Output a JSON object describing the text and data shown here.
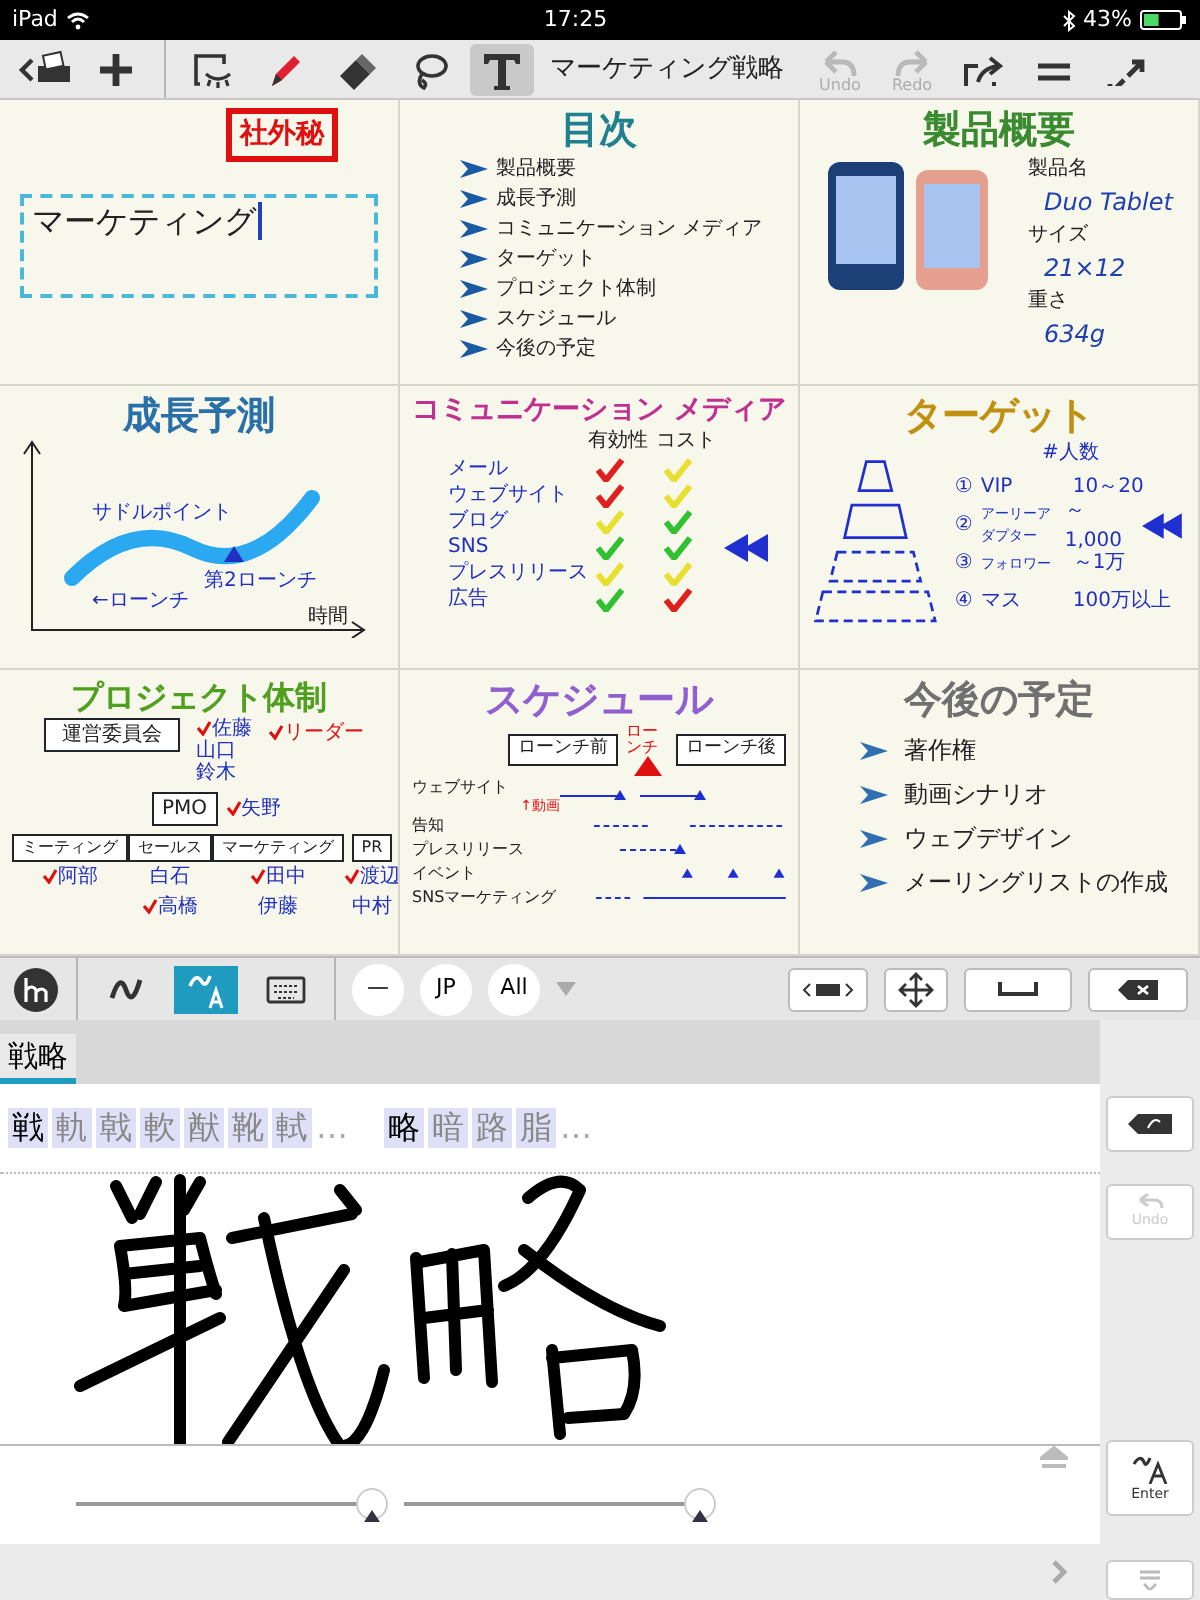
{
  "status_bar": {
    "device": "iPad",
    "time": "17:25",
    "battery": "43%"
  },
  "toolbar": {
    "tools": [
      {
        "kind": "back"
      },
      {
        "kind": "add"
      },
      {
        "kind": "select",
        "selected": false
      },
      {
        "kind": "pen",
        "selected": false
      },
      {
        "kind": "eraser",
        "selected": false
      },
      {
        "kind": "lasso",
        "selected": false
      },
      {
        "kind": "text",
        "selected": true
      }
    ],
    "title": "マーケティング戦略",
    "actions": [
      {
        "kind": "undo",
        "label": "Undo",
        "disabled": true
      },
      {
        "kind": "redo",
        "label": "Redo",
        "disabled": true
      },
      {
        "kind": "share"
      },
      {
        "kind": "menu"
      },
      {
        "kind": "expand"
      }
    ]
  },
  "panels": [
    {
      "kind": "cover",
      "stamp": "社外秘",
      "textbox": "マーケティング"
    },
    {
      "kind": "toc",
      "title": "目次",
      "items": [
        "製品概要",
        "成長予測",
        "コミュニケーション メディア",
        "ターゲット",
        "プロジェクト体制",
        "スケジュール",
        "今後の予定"
      ]
    },
    {
      "kind": "product",
      "title": "製品概要",
      "specs": [
        {
          "label": "製品名",
          "value": "Duo Tablet"
        },
        {
          "label": "サイズ",
          "value": "21×12"
        },
        {
          "label": "重さ",
          "value": "634g"
        }
      ]
    },
    {
      "kind": "growth",
      "title": "成長予測",
      "saddle": "サドルポイント",
      "launch": "←ローンチ",
      "second_launch": "第2ローンチ",
      "axis": "時間"
    },
    {
      "kind": "media",
      "title": "コミュニケーション メディア",
      "headers": [
        "有効性",
        "コスト"
      ],
      "rows": [
        {
          "name": "メール",
          "effect": {
            "color": "#e02020"
          },
          "cost": {
            "color": "#e8e030"
          },
          "pointed": false
        },
        {
          "name": "ウェブサイト",
          "effect": {
            "color": "#e02020"
          },
          "cost": {
            "color": "#e8e030"
          },
          "pointed": false
        },
        {
          "name": "ブログ",
          "effect": {
            "color": "#e8e030"
          },
          "cost": {
            "color": "#30c030"
          },
          "pointed": false
        },
        {
          "name": "SNS",
          "effect": {
            "color": "#30c030"
          },
          "cost": {
            "color": "#30c030"
          },
          "pointed": true
        },
        {
          "name": "プレスリリース",
          "effect": {
            "color": "#e8e030"
          },
          "cost": {
            "color": "#e8e030"
          },
          "pointed": false
        },
        {
          "name": "広告",
          "effect": {
            "color": "#30c030"
          },
          "cost": {
            "color": "#e02020"
          },
          "pointed": false
        }
      ]
    },
    {
      "kind": "target",
      "title": "ターゲット",
      "header": "#人数",
      "tiers": [
        {
          "num": "①",
          "name": "VIP",
          "count": "10～20",
          "pointed": false
        },
        {
          "num": "②",
          "name": "アーリーアダプター",
          "count": "～1,000",
          "pointed": true
        },
        {
          "num": "③",
          "name": "フォロワー",
          "count": "～1万",
          "pointed": false
        },
        {
          "num": "④",
          "name": "マス",
          "count": "100万以上",
          "pointed": false
        }
      ]
    },
    {
      "kind": "org",
      "title": "プロジェクト体制",
      "committee": "運営委員会",
      "committee_members": [
        {
          "name": "佐藤",
          "leader": true
        },
        {
          "name": "山口",
          "leader": false
        },
        {
          "name": "鈴木",
          "leader": false
        }
      ],
      "legend": "リーダー",
      "pmo": "PMO",
      "pmo_member": {
        "name": "矢野",
        "leader": true
      },
      "teams": [
        {
          "name": "ミーティング",
          "members": [
            {
              "name": "阿部",
              "leader": true
            }
          ]
        },
        {
          "name": "セールス",
          "members": [
            {
              "name": "白石",
              "leader": false
            },
            {
              "name": "高橋",
              "leader": true
            }
          ]
        },
        {
          "name": "マーケティング",
          "members": [
            {
              "name": "田中",
              "leader": true
            },
            {
              "name": "伊藤",
              "leader": false
            }
          ]
        },
        {
          "name": "PR",
          "members": [
            {
              "name": "渡辺",
              "leader": true
            },
            {
              "name": "中村",
              "leader": false
            }
          ]
        }
      ]
    },
    {
      "kind": "schedule",
      "title": "スケジュール",
      "before": "ローンチ前",
      "launch": "ローンチ",
      "after": "ローンチ後",
      "rows": [
        {
          "name": "ウェブサイト",
          "note": "↑動画"
        },
        {
          "name": "告知"
        },
        {
          "name": "プレスリリース"
        },
        {
          "name": "イベント"
        },
        {
          "name": "SNSマーケティング"
        }
      ]
    },
    {
      "kind": "plans",
      "title": "今後の予定",
      "items": [
        "著作権",
        "動画シナリオ",
        "ウェブデザイン",
        "メーリングリストの作成"
      ]
    }
  ],
  "keyboard": {
    "modes": [
      {
        "kind": "stroke",
        "selected": false
      },
      {
        "kind": "handwriting",
        "selected": true
      },
      {
        "kind": "keyboard",
        "selected": false
      }
    ],
    "filters": [
      "—",
      "JP",
      "All"
    ],
    "tabs": [
      {
        "label": "戦略",
        "selected": true
      }
    ],
    "candidate_groups": [
      {
        "chars": [
          "戦",
          "軌",
          "戟",
          "軟",
          "猷",
          "靴",
          "軾"
        ],
        "more": "…"
      },
      {
        "chars": [
          "略",
          "暗",
          "路",
          "脂"
        ],
        "more": "…"
      }
    ],
    "side_undo": {
      "label": "Undo",
      "disabled": true
    },
    "enter": "Enter",
    "sliders": [
      {
        "level": 1
      },
      {
        "level": 1
      }
    ]
  }
}
